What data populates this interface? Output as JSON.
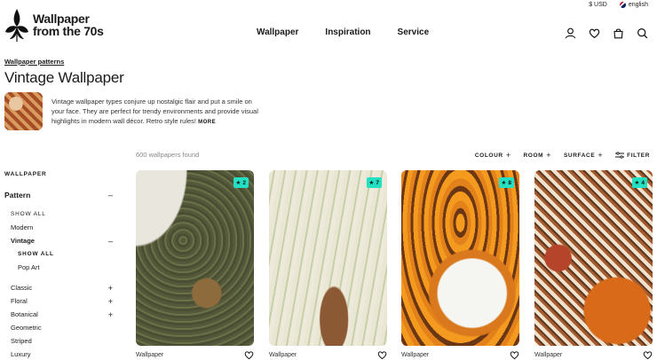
{
  "topbar": {
    "currency": "$ USD",
    "language": "english"
  },
  "logo": {
    "line1": "Wallpaper",
    "line2": "from the 70s"
  },
  "nav": [
    "Wallpaper",
    "Inspiration",
    "Service"
  ],
  "breadcrumb": "Wallpaper patterns",
  "page_title": "Vintage Wallpaper",
  "intro": {
    "text": "Vintage wallpaper types conjure up nostalgic flair and put a smile on your face. They are perfect for trendy environments and provide visual highlights in modern wall décor. Retro style rules!",
    "more": "MORE"
  },
  "results": {
    "count_text": "600 wallpapers found"
  },
  "filters": [
    "COLOUR",
    "ROOM",
    "SURFACE",
    "FILTER"
  ],
  "sidebar": {
    "heading": "WALLPAPER",
    "pattern_label": "Pattern",
    "show_all": "SHOW ALL",
    "modern": "Modern",
    "vintage": "Vintage",
    "vintage_show_all": "SHOW ALL",
    "pop_art": "Pop Art",
    "classic": "Classic",
    "floral": "Floral",
    "botanical": "Botanical",
    "geometric": "Geometric",
    "striped": "Striped",
    "luxury": "Luxury"
  },
  "products": [
    {
      "label": "Wallpaper",
      "stars": "2"
    },
    {
      "label": "Wallpaper",
      "stars": "7"
    },
    {
      "label": "Wallpaper",
      "stars": "8"
    },
    {
      "label": "Wallpaper",
      "stars": "4"
    }
  ],
  "colors": {
    "badge": "#23e0c2",
    "text": "#1a1a1a"
  }
}
